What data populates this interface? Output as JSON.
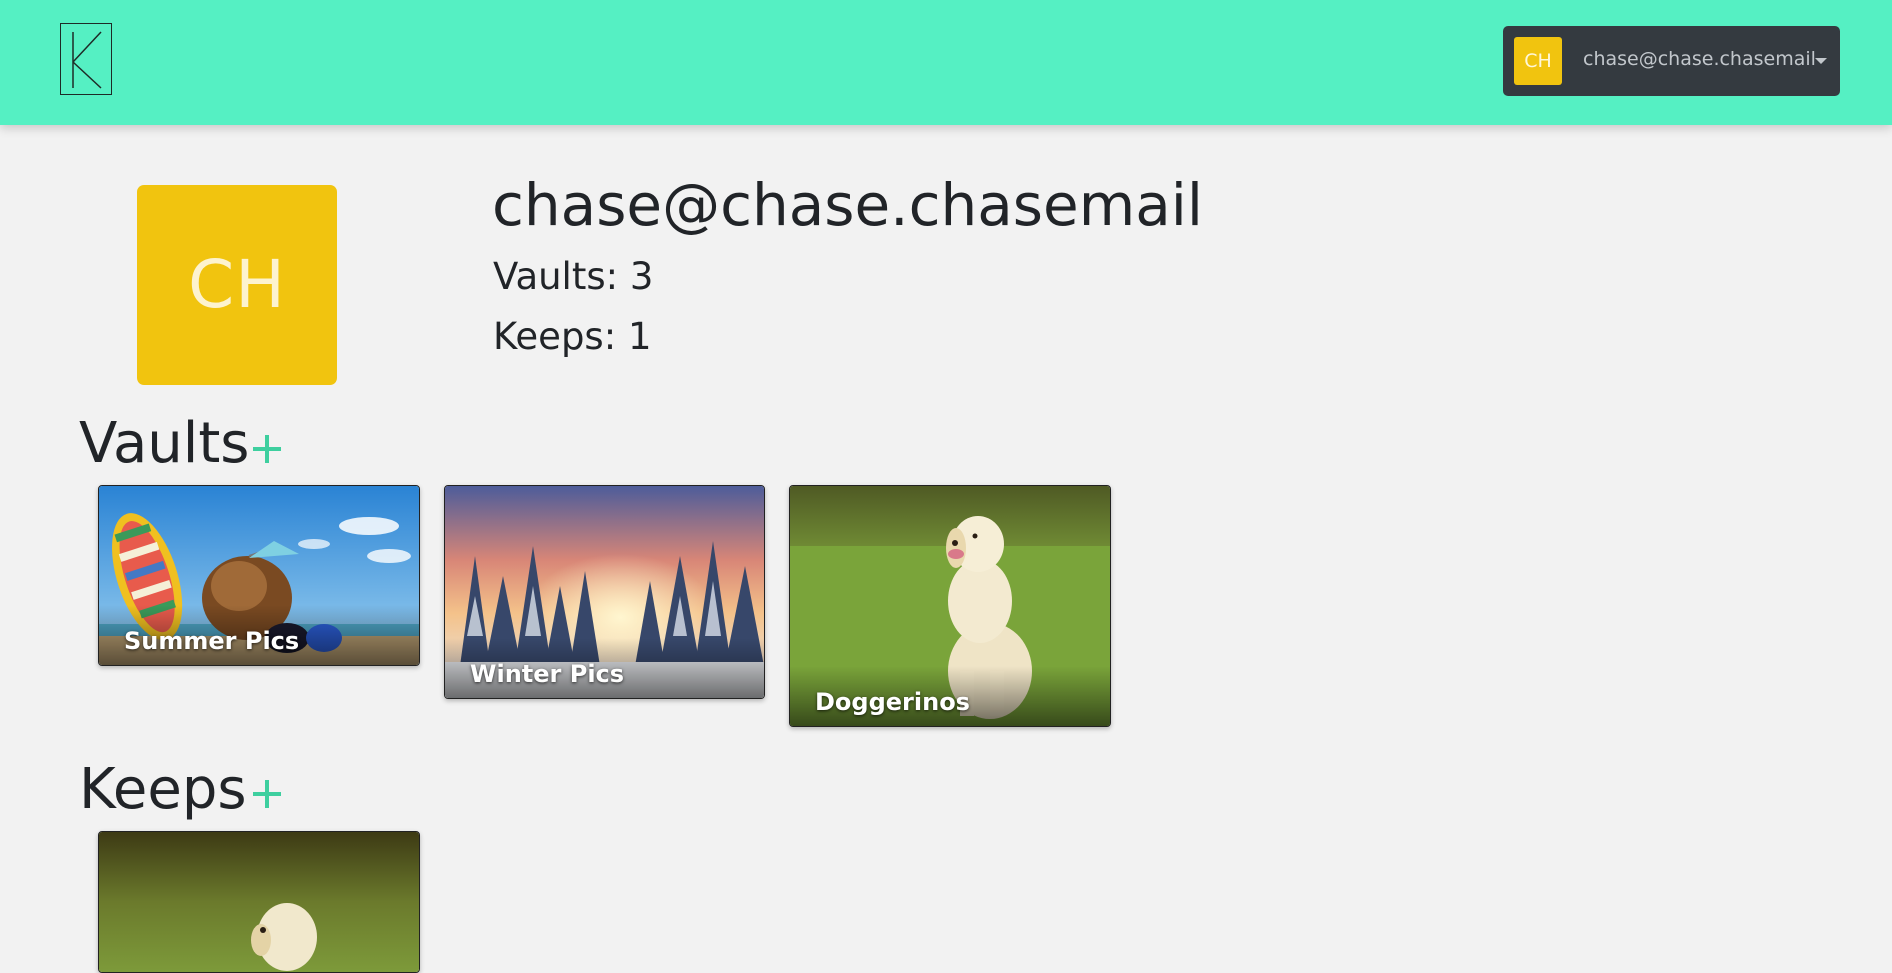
{
  "navbar": {
    "logo_letter": "K",
    "account": {
      "initials": "CH",
      "email": "chase@chase.chasemail"
    }
  },
  "profile": {
    "initials": "CH",
    "email": "chase@chase.chasemail",
    "vaults_stat": "Vaults: 3",
    "keeps_stat": "Keeps: 1"
  },
  "sections": {
    "vaults_title": "Vaults",
    "keeps_title": "Keeps"
  },
  "vaults": [
    {
      "name": "Summer Pics"
    },
    {
      "name": "Winter Pics"
    },
    {
      "name": "Doggerinos"
    }
  ],
  "colors": {
    "navbar": "#55f0c3",
    "avatar": "#f1c40f",
    "accent": "#3ecf9f",
    "account_button": "#343a40",
    "background": "#f2f2f2"
  }
}
